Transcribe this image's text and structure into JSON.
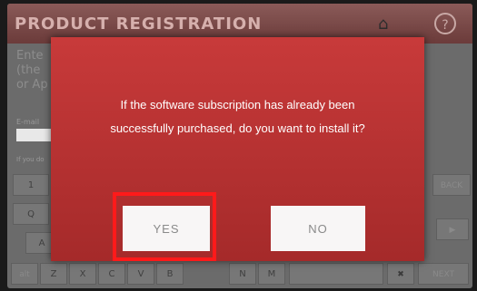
{
  "header": {
    "title": "PRODUCT REGISTRATION",
    "home_icon": "home-icon",
    "help_label": "?"
  },
  "background": {
    "lines": [
      "Ente",
      "(the",
      "or Ap"
    ],
    "email_label": "E-mail",
    "small_text": "If you do"
  },
  "keyboard": {
    "row1": [
      "1"
    ],
    "row2": [
      "Q"
    ],
    "row3": [
      "A"
    ],
    "row4": [
      "alt",
      "Z",
      "X",
      "C",
      "V",
      "B",
      "N",
      "M"
    ],
    "back_label": "BACK",
    "next_label": "NEXT",
    "right_arrow": "▶",
    "clear_label": "✖"
  },
  "dialog": {
    "message_line1": "If the software subscription has already been",
    "message_line2": "successfully purchased, do you want to install it?",
    "yes_label": "YES",
    "no_label": "NO",
    "highlight_color": "#ff1a1a",
    "background_color": "#b83333"
  }
}
